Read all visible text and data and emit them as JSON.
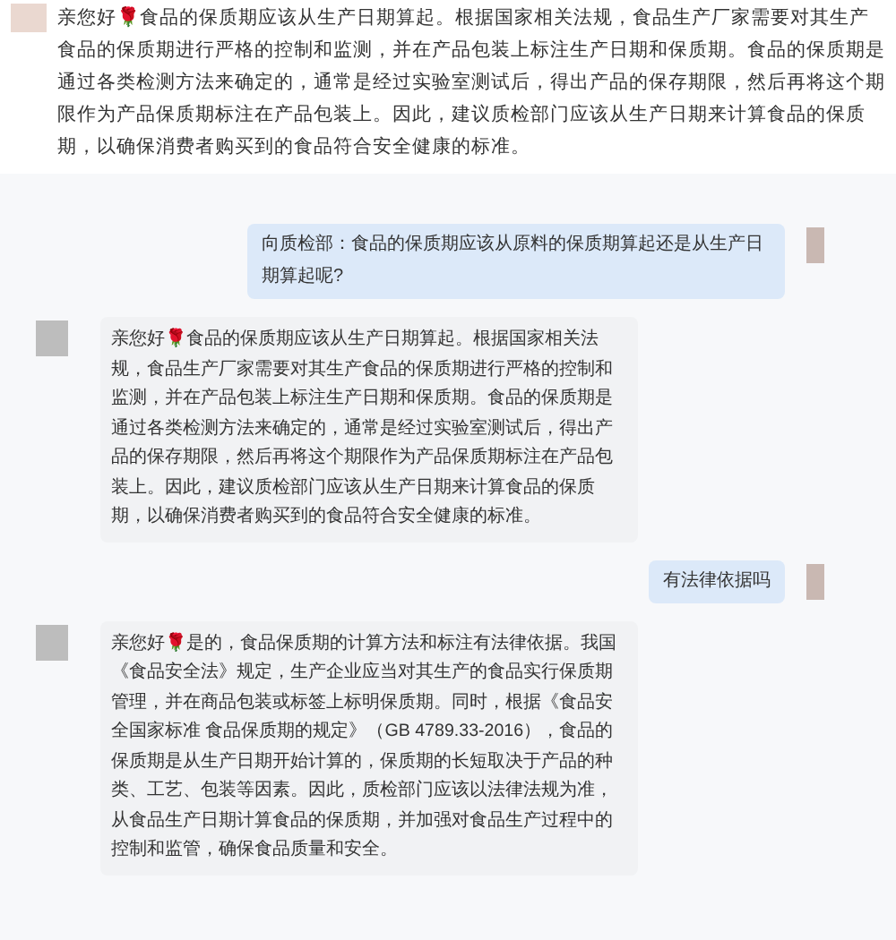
{
  "previous_reply": {
    "text": "亲您好🌹食品的保质期应该从生产日期算起。根据国家相关法规，食品生产厂家需要对其生产食品的保质期进行严格的控制和监测，并在产品包装上标注生产日期和保质期。食品的保质期是通过各类检测方法来确定的，通常是经过实验室测试后，得出产品的保存期限，然后再将这个期限作为产品保质期标注在产品包装上。因此，建议质检部门应该从生产日期来计算食品的保质期，以确保消费者购买到的食品符合安全健康的标准。"
  },
  "messages": [
    {
      "kind": "sent",
      "text": "向质检部：食品的保质期应该从原料的保质期算起还是从生产日期算起呢?"
    },
    {
      "kind": "received",
      "text": "亲您好🌹食品的保质期应该从生产日期算起。根据国家相关法规，食品生产厂家需要对其生产食品的保质期进行严格的控制和监测，并在产品包装上标注生产日期和保质期。食品的保质期是通过各类检测方法来确定的，通常是经过实验室测试后，得出产品的保存期限，然后再将这个期限作为产品保质期标注在产品包装上。因此，建议质检部门应该从生产日期来计算食品的保质期，以确保消费者购买到的食品符合安全健康的标准。"
    },
    {
      "kind": "sent",
      "text": "有法律依据吗"
    },
    {
      "kind": "received",
      "text": "亲您好🌹是的，食品保质期的计算方法和标注有法律依据。我国《食品安全法》规定，生产企业应当对其生产的食品实行保质期管理，并在商品包装或标签上标明保质期。同时，根据《食品安全国家标准 食品保质期的规定》（GB 4789.33-2016），食品的保质期是从生产日期开始计算的，保质期的长短取决于产品的种类、工艺、包装等因素。因此，质检部门应该以法律法规为准，从食品生产日期计算食品的保质期，并加强对食品生产过程中的控制和监管，确保食品质量和安全。"
    }
  ]
}
